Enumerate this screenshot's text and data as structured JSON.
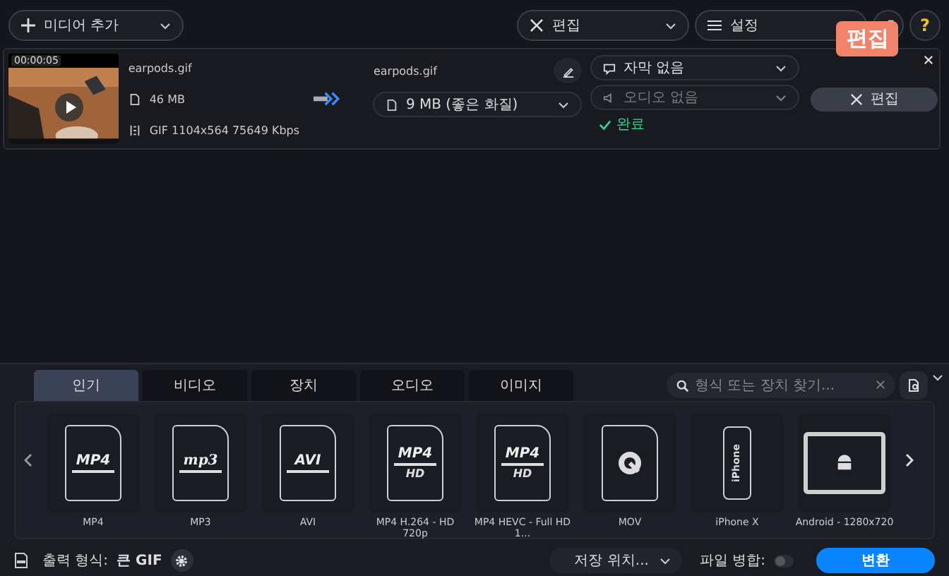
{
  "toolbar": {
    "add_media": "미디어 추가",
    "edit": "편집",
    "settings": "설정",
    "help": "?"
  },
  "file": {
    "duration": "00:00:05",
    "source_name": "earpods.gif",
    "source_size": "46 MB",
    "source_info": "GIF 1104x564 75649 Kbps",
    "output_name": "earpods.gif",
    "output_size": "9 MB (좋은 화질)",
    "subtitle": "자막 없음",
    "audio": "오디오 없음",
    "audio_disabled": true,
    "status": "완료",
    "edit_button": "편집",
    "tooltip": "편집"
  },
  "tabs": [
    {
      "label": "인기",
      "selected": true
    },
    {
      "label": "비디오",
      "selected": false
    },
    {
      "label": "장치",
      "selected": false
    },
    {
      "label": "오디오",
      "selected": false
    },
    {
      "label": "이미지",
      "selected": false
    }
  ],
  "search": {
    "placeholder": "형식 또는 장치 찾기..."
  },
  "formats": [
    {
      "kind": "doc",
      "badge": "MP4",
      "label": "MP4"
    },
    {
      "kind": "doc",
      "badge": "mp3",
      "label": "MP3"
    },
    {
      "kind": "doc",
      "badge": "AVI",
      "label": "AVI"
    },
    {
      "kind": "doc",
      "badge": "MP4",
      "sub": "HD",
      "label": "MP4 H.264 - HD 720p"
    },
    {
      "kind": "doc",
      "badge": "MP4",
      "sub": "HD",
      "label": "MP4 HEVC - Full HD 1..."
    },
    {
      "kind": "mov",
      "label": "MOV"
    },
    {
      "kind": "phone",
      "badge": "iPhone",
      "label": "iPhone X"
    },
    {
      "kind": "tablet",
      "label": "Android - 1280x720"
    }
  ],
  "footer": {
    "output_label": "출력 형식:",
    "output_value": "큰 GIF",
    "save": "저장 위치...",
    "merge": "파일 병합:",
    "merge_on": false,
    "convert": "변환"
  }
}
